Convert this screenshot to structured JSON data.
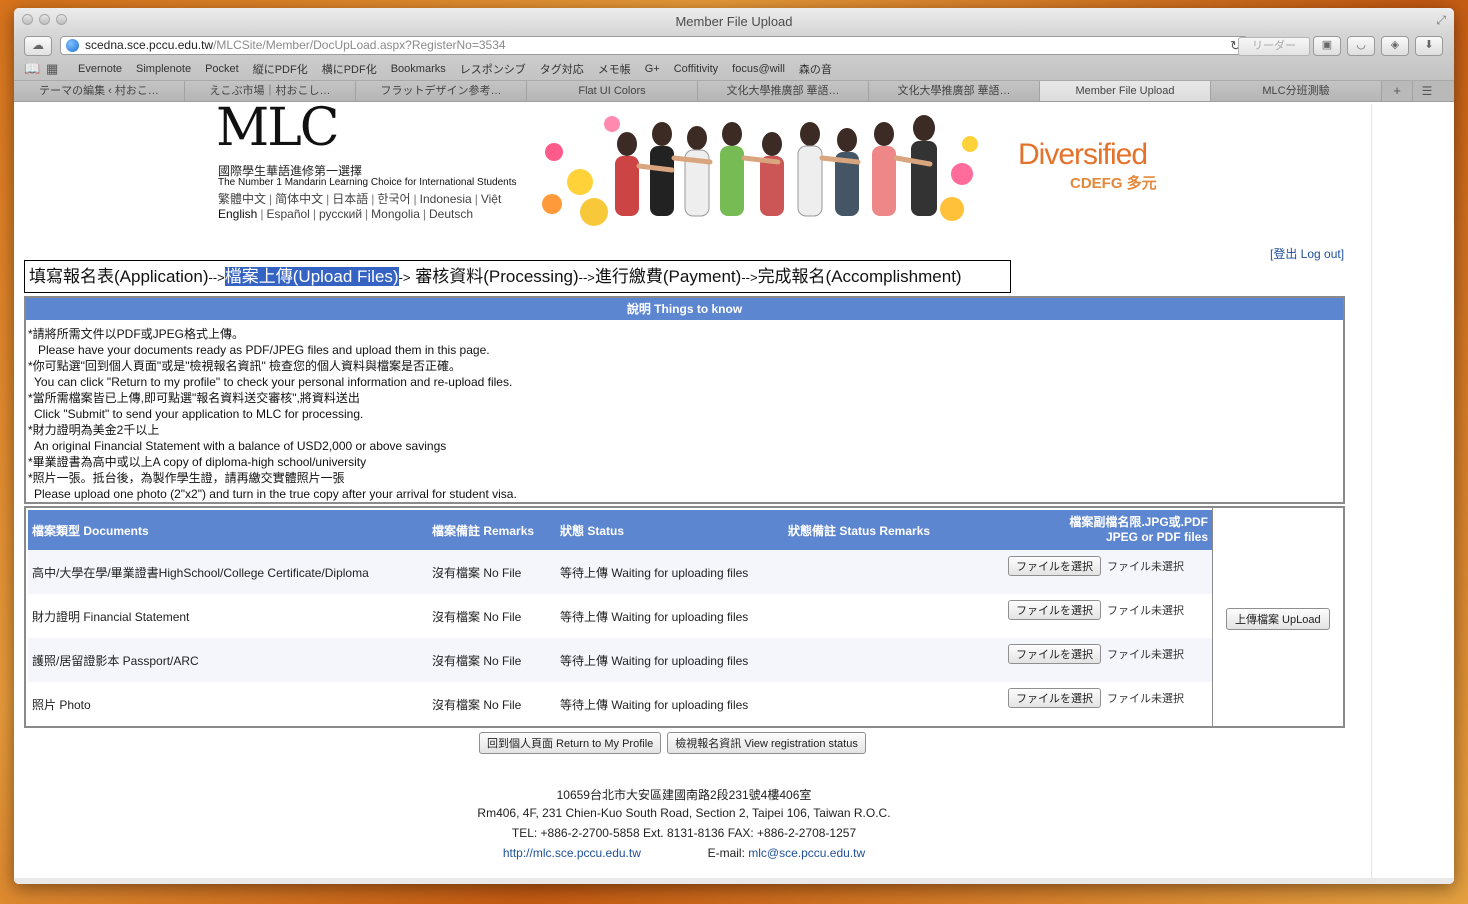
{
  "window": {
    "title": "Member File Upload"
  },
  "url": {
    "host": "scedna.sce.pccu.edu.tw",
    "path": "/MLCSite/Member/DocUpLoad.aspx?RegisterNo=3534"
  },
  "reader_label": "リーダー",
  "bookmarks": [
    "Evernote",
    "Simplenote",
    "Pocket",
    "縦にPDF化",
    "横にPDF化",
    "Bookmarks",
    "レスポンシブ",
    "タグ対応",
    "メモ帳",
    "G+",
    "Coffitivity",
    "focus@will",
    "森の音"
  ],
  "tabs": [
    "テーマの編集 ‹ 村おこ…",
    "えこぶ市場｜村おこし…",
    "フラットデザイン参考…",
    "Flat UI Colors",
    "文化大學推廣部 華語…",
    "文化大學推廣部 華語…",
    "Member File Upload",
    "MLC分班測驗"
  ],
  "banner": {
    "logo": "MLC",
    "logo_cn": "國際學生華語進修第一選擇",
    "logo_en": "The Number 1 Mandarin Learning Choice for International Students",
    "langs_row1": [
      "繁體中文",
      "简体中文",
      "日本語",
      "한국어",
      "Indonesia",
      "Việt"
    ],
    "langs_row2": [
      "English",
      "Español",
      "русский",
      "Mongolia",
      "Deutsch"
    ],
    "diversified": "Diversified",
    "cdefg": "CDEFG 多元"
  },
  "logout": "[登出 Log out]",
  "steps": {
    "s1": "填寫報名表(Application)",
    "s2": "檔案上傳(Upload Files)",
    "s3": "審核資料(Processing)",
    "s4": "進行繳費(Payment)",
    "s5": "完成報名(Accomplishment)",
    "arrow": "-->",
    "arrow_short": "->"
  },
  "notice": {
    "title": "說明 Things to know",
    "lines": [
      "*請將所需文件以PDF或JPEG格式上傳。",
      "Please have your documents ready as PDF/JPEG files and upload them in this page.",
      "*你可點選\"回到個人頁面\"或是\"檢視報名資訊\" 檢查您的個人資料與檔案是否正確。",
      "You can click  \"Return to my profile\" to check your personal information and re-upload files.",
      "*當所需檔案皆已上傳,即可點選\"報名資料送交審核\",將資料送出",
      "Click \"Submit\" to send your application to MLC for processing.",
      "*財力證明為美金2千以上",
      "An original Financial Statement with a balance of USD2,000 or above savings",
      "*畢業證書為高中或以上A copy of diploma-high school/university",
      "*照片一張。抵台後，為製作學生證，請再繳交實體照片一張",
      "Please upload one photo (2\"x2\") and turn in the true copy after your arrival for student visa."
    ]
  },
  "files": {
    "headers": {
      "documents": "檔案類型 Documents",
      "remarks": "檔案備註 Remarks",
      "status": "狀態 Status",
      "status_remarks": "狀態備註 Status Remarks",
      "ext1": "檔案副檔名限.JPG或.PDF",
      "ext2": "JPEG or PDF files"
    },
    "rows": [
      {
        "doc": "高中/大學在學/畢業證書HighSchool/College Certificate/Diploma",
        "remark": "沒有檔案 No File",
        "status": "等待上傳 Waiting for uploading files"
      },
      {
        "doc": "財力證明 Financial Statement",
        "remark": "沒有檔案 No File",
        "status": "等待上傳 Waiting for uploading files"
      },
      {
        "doc": "護照/居留證影本 Passport/ARC",
        "remark": "沒有檔案 No File",
        "status": "等待上傳 Waiting for uploading files"
      },
      {
        "doc": "照片 Photo",
        "remark": "沒有檔案 No File",
        "status": "等待上傳 Waiting for uploading files"
      }
    ],
    "choose_label": "ファイルを選択",
    "no_file_label": "ファイル未選択",
    "upload_label": "上傳檔案 UpLoad"
  },
  "buttons": {
    "profile": "回到個人頁面 Return to My Profile",
    "status": "檢視報名資訊 View registration status"
  },
  "footer": {
    "addr_cn": "10659台北市大安區建國南路2段231號4樓406室",
    "addr_en": "Rm406, 4F, 231 Chien-Kuo South Road, Section 2, Taipei 106, Taiwan R.O.C.",
    "tel": "TEL: +886-2-2700-5858 Ext. 8131-8136   FAX: +886-2-2708-1257",
    "web": "http://mlc.sce.pccu.edu.tw",
    "email_label": "E-mail:",
    "email": "mlc@sce.pccu.edu.tw"
  }
}
